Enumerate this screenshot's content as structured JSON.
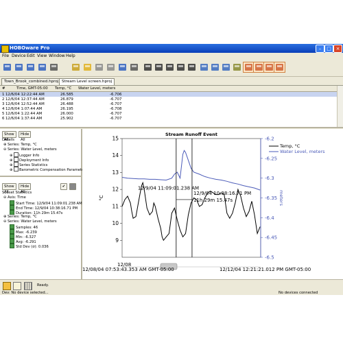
{
  "app": {
    "title": "HOBOware Pro"
  },
  "menu": [
    "File",
    "Device",
    "Edit",
    "View",
    "Window",
    "Help"
  ],
  "toolbar": {
    "icons": [
      "launch-icon",
      "readout-icon",
      "status-icon",
      "relaunch-icon",
      "device-dropdown-icon",
      "new-icon",
      "open-icon",
      "close-file-icon",
      "close-all-icon",
      "save-icon",
      "print-icon",
      "pointer-icon",
      "crosshair-icon",
      "pan-icon",
      "zoom-icon",
      "marker-icon",
      "zoom-in-icon",
      "zoom-out-icon",
      "zoom-reset-icon",
      "highlight-icon",
      "chart-options-icon",
      "chart-overlay-icon",
      "chart-series-icon",
      "chart-export-icon"
    ]
  },
  "tabs": [
    {
      "label": "Town_Brook_combined.hproj",
      "active": false
    },
    {
      "label": "Stream Level screen.hproj",
      "active": true
    }
  ],
  "table": {
    "headers": [
      "#",
      "Time, GMT-05:00",
      "Temp, °C",
      "Water Level, meters"
    ],
    "rows": [
      [
        "1",
        "12/6/04 12:22:44 AM",
        "26.585",
        "-6.706"
      ],
      [
        "2",
        "12/6/04 12:37:44 AM",
        "26.879",
        "-6.707"
      ],
      [
        "3",
        "12/6/04 12:52:44 AM",
        "26.488",
        "-6.707"
      ],
      [
        "4",
        "12/6/04 1:07:44 AM",
        "26.195",
        "-6.708"
      ],
      [
        "5",
        "12/6/04 1:22:44 AM",
        "26.000",
        "-6.707"
      ],
      [
        "6",
        "12/6/04 1:37:44 AM",
        "25.902",
        "-6.707"
      ]
    ]
  },
  "details": {
    "show_all": "Show All",
    "hide_all": "Hide All",
    "title": "Details",
    "items": [
      "Series: Temp, °C",
      "Series: Water Level, meters",
      "Logger Info",
      "Deployment Info",
      "Series Statistics",
      "Barometric Compensation Paramete"
    ]
  },
  "subset": {
    "show_all": "Show All",
    "hide_all": "Hide All",
    "title": "Subset Statistics",
    "axis_time": "Axis: Time",
    "start": "Start Time: 12/9/04 11:09:01.238 AM",
    "end": "End Time: 12/9/04 10:38:16.71 PM",
    "duration": "Duration: 11h 29m 15.47s",
    "series_temp": "Series: Temp, °C",
    "series_water": "Series: Water Level, meters",
    "samples": "Samples: 46",
    "max": "Max: -6.239",
    "min": "Min: -6.327",
    "avg": "Avg: -6.291",
    "std": "Std Dev (σ): 0.036"
  },
  "chart_data": {
    "type": "line",
    "title": "Stream Runoff Event",
    "ylabel_left": "°C",
    "ylabel_right": "meters",
    "y_left": {
      "min": 8,
      "max": 15,
      "ticks": [
        9,
        10,
        11,
        12,
        13,
        14,
        15
      ]
    },
    "y_right": {
      "min": -6.2,
      "max": -6.5,
      "ticks": [
        -6.2,
        -6.25,
        -6.3,
        -6.35,
        -6.4,
        -6.45,
        -6.5
      ],
      "tick_labels": [
        "-6.2",
        "-6.25",
        "-6.3",
        "-6.35",
        "-6.4",
        "-6.45",
        "-6.5"
      ]
    },
    "x_start_label": "12/08/04 07:53:43.353 AM GMT-05:00",
    "x_end_label": "12/12/04 12:21:21.012 PM GMT-05:00",
    "corner_label": "12/08",
    "x_range_hours": [
      0,
      100.46
    ],
    "series": [
      {
        "name": "Temp, °C",
        "axis": "left",
        "color": "#000000",
        "x": [
          0,
          2,
          4,
          6,
          7,
          8,
          10,
          12,
          14,
          15,
          16,
          18,
          20,
          22,
          23,
          24,
          26,
          28,
          29,
          30,
          32,
          34,
          36,
          38,
          40,
          42,
          44,
          46,
          48,
          50,
          52,
          54,
          56,
          58,
          60,
          62,
          64,
          66,
          68,
          70,
          72,
          74,
          76,
          78,
          80,
          82,
          84,
          86,
          88,
          90,
          92,
          94,
          96,
          98,
          100
        ],
        "y": [
          11.0,
          11.4,
          11.6,
          11.2,
          10.7,
          10.3,
          10.4,
          11.3,
          12.2,
          12.4,
          12.0,
          10.9,
          10.5,
          10.7,
          11.2,
          11.0,
          10.3,
          9.7,
          9.2,
          9.0,
          9.2,
          9.4,
          10.6,
          10.9,
          10.2,
          9.6,
          9.2,
          9.4,
          10.5,
          11.2,
          11.5,
          11.4,
          11.0,
          11.1,
          11.5,
          11.8,
          11.9,
          11.8,
          11.7,
          11.7,
          11.8,
          11.7,
          10.6,
          10.3,
          10.6,
          11.2,
          12.0,
          11.6,
          10.9,
          10.4,
          10.7,
          11.3,
          10.5,
          9.4,
          9.8
        ]
      },
      {
        "name": "Water Level, meters",
        "axis": "right",
        "color": "#4a5ab8",
        "x": [
          0,
          4,
          8,
          12,
          16,
          20,
          24,
          28,
          32,
          36,
          38,
          40,
          42,
          44,
          45,
          46,
          48,
          50,
          52,
          56,
          60,
          64,
          68,
          72,
          76,
          80,
          84,
          88,
          92,
          96,
          100
        ],
        "y": [
          -6.298,
          -6.3,
          -6.301,
          -6.302,
          -6.302,
          -6.303,
          -6.303,
          -6.304,
          -6.305,
          -6.3,
          -6.29,
          -6.285,
          -6.3,
          -6.24,
          -6.23,
          -6.235,
          -6.255,
          -6.275,
          -6.285,
          -6.29,
          -6.296,
          -6.3,
          -6.303,
          -6.305,
          -6.308,
          -6.312,
          -6.315,
          -6.319,
          -6.322,
          -6.325,
          -6.33
        ]
      }
    ],
    "annotations": {
      "cursor_1_hour": 39.2,
      "cursor_2_hour": 50.7,
      "label_1": "12/9/04 11:09:01.238 AM",
      "label_2": "12/9/04 10:38:16.71 PM",
      "span": "11h 29m 15.47s"
    },
    "legend": {
      "placement": "top-right",
      "items": [
        "Temp, °C",
        "Water Level, meters"
      ]
    },
    "grid": false
  },
  "status": {
    "ready": "Ready.",
    "device": "Dev: No device selected...",
    "connection": "No devices connected"
  },
  "colors": {
    "titlebar": "#0a3fb8",
    "selected_row": "#c8d4f0",
    "water_series": "#4a5ab8",
    "highlight_toolbar": "#d08040"
  }
}
